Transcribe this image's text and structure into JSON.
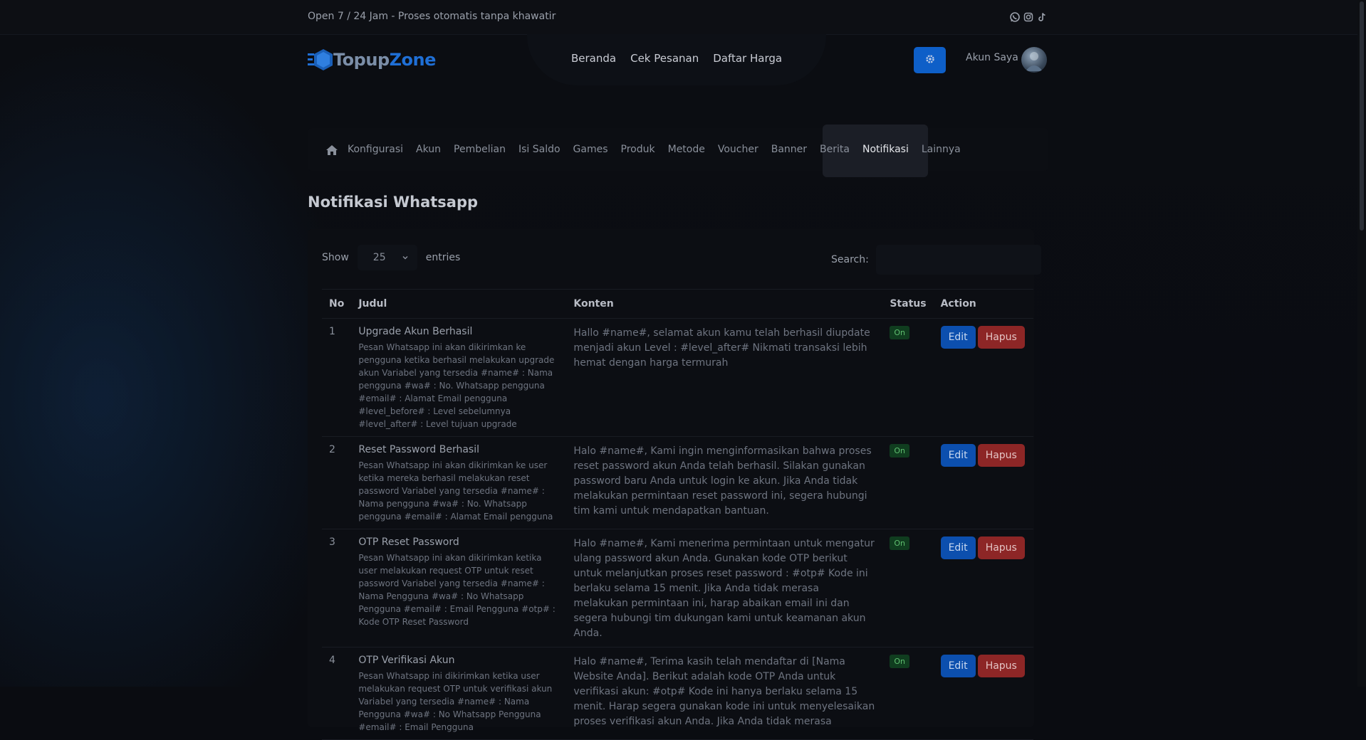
{
  "topbar": {
    "message": "Open 7 / 24 Jam - Proses otomatis tanpa khawatir",
    "social": [
      "whatsapp-icon",
      "instagram-icon",
      "tiktok-icon"
    ]
  },
  "logo": {
    "part1": "Topup",
    "part2": "Zone"
  },
  "nav": {
    "items": [
      "Beranda",
      "Cek Pesanan",
      "Daftar Harga"
    ]
  },
  "account": {
    "label": "Akun Saya"
  },
  "subnav": {
    "items": [
      "Konfigurasi",
      "Akun",
      "Pembelian",
      "Isi Saldo",
      "Games",
      "Produk",
      "Metode",
      "Voucher",
      "Banner",
      "Berita",
      "Notifikasi",
      "Lainnya"
    ],
    "active": "Notifikasi"
  },
  "page": {
    "title": "Notifikasi Whatsapp"
  },
  "table_controls": {
    "show_label": "Show",
    "entries_value": "25",
    "entries_label": "entries",
    "search_label": "Search:",
    "search_value": ""
  },
  "table": {
    "headers": [
      "No",
      "Judul",
      "Konten",
      "Status",
      "Action"
    ],
    "rows": [
      {
        "no": "1",
        "judul": "Upgrade Akun Berhasil",
        "desc": "Pesan Whatsapp ini akan dikirimkan ke pengguna ketika berhasil melakukan upgrade akun Variabel yang tersedia #name# : Nama pengguna #wa# : No. Whatsapp pengguna #email# : Alamat Email pengguna #level_before# : Level sebelumnya #level_after# : Level tujuan upgrade",
        "konten": "Hallo #name#, selamat akun kamu telah berhasil diupdate menjadi akun Level : #level_after# Nikmati transaksi lebih hemat dengan harga termurah",
        "status": "On",
        "edit": "Edit",
        "hapus": "Hapus"
      },
      {
        "no": "2",
        "judul": "Reset Password Berhasil",
        "desc": "Pesan Whatsapp ini akan dikirimkan ke user ketika mereka berhasil melakukan reset password Variabel yang tersedia #name# : Nama pengguna #wa# : No. Whatsapp pengguna #email# : Alamat Email pengguna",
        "konten": "Halo #name#, Kami ingin menginformasikan bahwa proses reset password akun Anda telah berhasil. Silakan gunakan password baru Anda untuk login ke akun. Jika Anda tidak melakukan permintaan reset password ini, segera hubungi tim kami untuk mendapatkan bantuan.",
        "status": "On",
        "edit": "Edit",
        "hapus": "Hapus"
      },
      {
        "no": "3",
        "judul": "OTP Reset Password",
        "desc": "Pesan Whatsapp ini akan dikirimkan ketika user melakukan request OTP untuk reset password Variabel yang tersedia #name# : Nama Pengguna #wa# : No Whatsapp Pengguna #email# : Email Pengguna #otp# : Kode OTP Reset Password",
        "konten": "Halo #name#, Kami menerima permintaan untuk mengatur ulang password akun Anda. Gunakan kode OTP berikut untuk melanjutkan proses reset password : #otp# Kode ini berlaku selama 15 menit. Jika Anda tidak merasa melakukan permintaan ini, harap abaikan email ini dan segera hubungi tim dukungan kami untuk keamanan akun Anda.",
        "status": "On",
        "edit": "Edit",
        "hapus": "Hapus"
      },
      {
        "no": "4",
        "judul": "OTP Verifikasi Akun",
        "desc": "Pesan Whatsapp ini dikirimkan ketika user melakukan request OTP untuk verifikasi akun Variabel yang tersedia #name# : Nama Pengguna #wa# : No Whatsapp Pengguna #email# : Email Pengguna",
        "konten": "Halo #name#, Terima kasih telah mendaftar di [Nama Website Anda]. Berikut adalah kode OTP  Anda untuk verifikasi akun: #otp# Kode ini hanya berlaku selama 15 menit. Harap segera gunakan kode ini untuk menyelesaikan proses verifikasi akun Anda. Jika Anda tidak merasa",
        "status": "On",
        "edit": "Edit",
        "hapus": "Hapus"
      }
    ]
  },
  "colors": {
    "background": "#0a0c11",
    "primary": "#0e5fc8",
    "danger": "#8d2626",
    "success_badge": "#103d1f"
  }
}
